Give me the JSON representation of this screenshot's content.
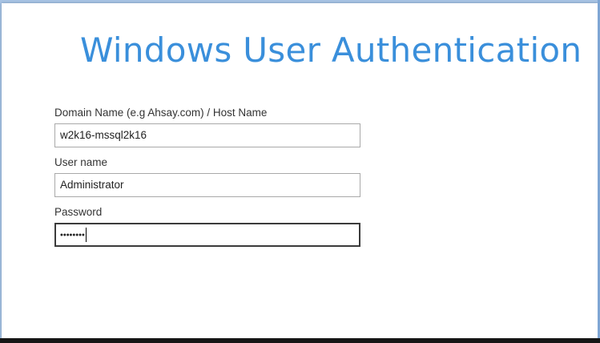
{
  "dialog": {
    "title": "Windows User Authentication"
  },
  "form": {
    "domain": {
      "label": "Domain Name (e.g Ahsay.com) / Host Name",
      "value": "w2k16-mssql2k16"
    },
    "username": {
      "label": "User name",
      "value": "Administrator"
    },
    "password": {
      "label": "Password",
      "masked_value": "••••••••"
    }
  },
  "colors": {
    "title": "#3a8fdb",
    "border_focused": "#3b3b3b",
    "border_default": "#a9a9a9"
  }
}
